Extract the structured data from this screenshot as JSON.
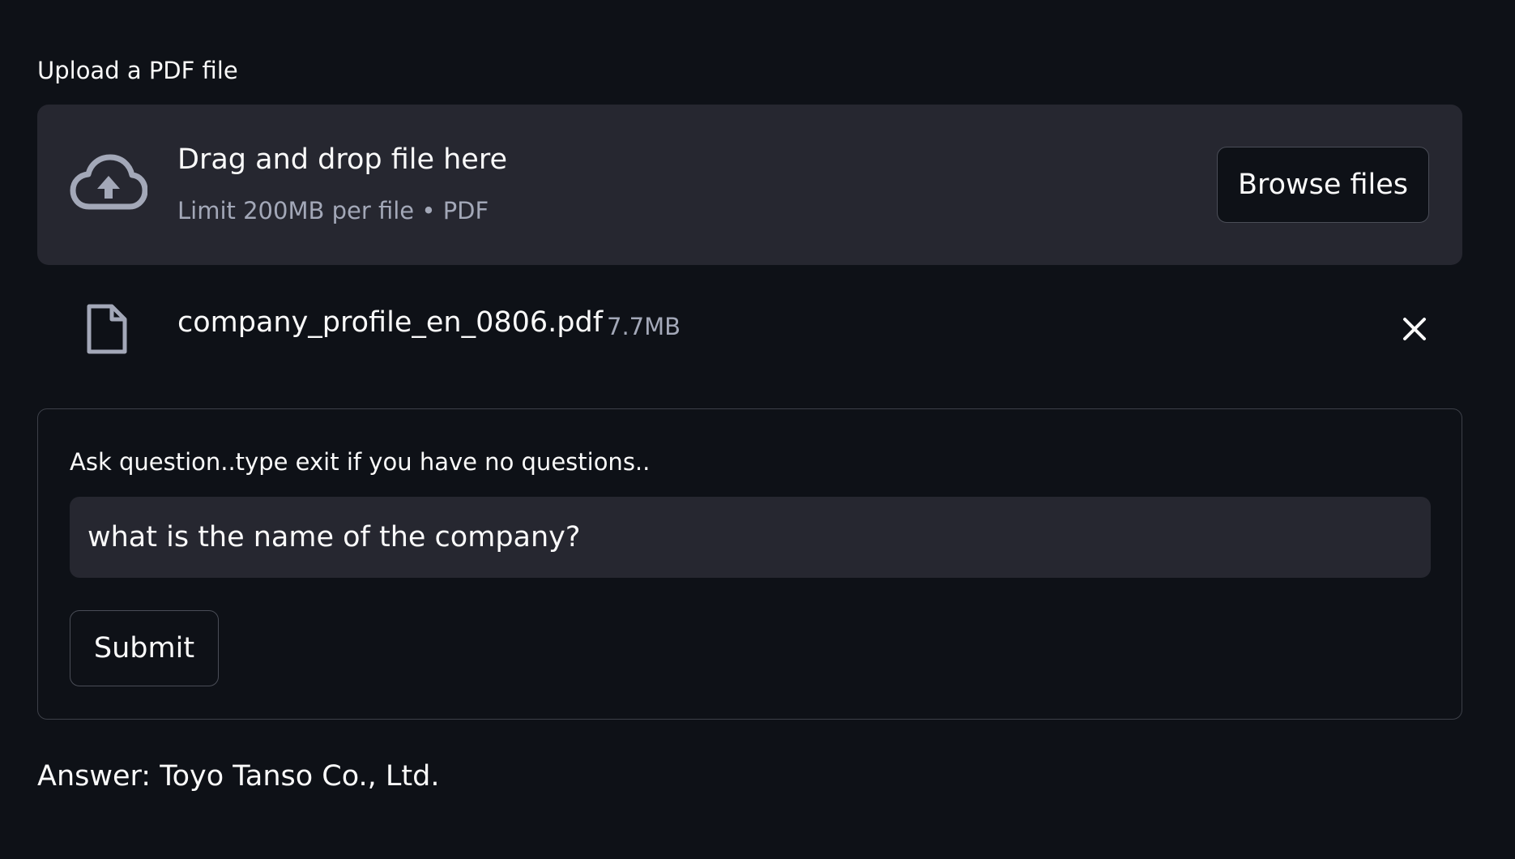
{
  "uploader": {
    "label": "Upload a PDF file",
    "drop_title": "Drag and drop file here",
    "drop_subtitle": "Limit 200MB per file • PDF",
    "browse_label": "Browse files",
    "icon": "cloud-upload-icon"
  },
  "uploaded_file": {
    "name": "company_profile_en_0806.pdf",
    "size": "7.7MB",
    "icon": "file-icon",
    "remove_icon": "close-icon"
  },
  "form": {
    "question_label": "Ask question..type exit if you have no questions..",
    "question_value": "what is the name of the company?",
    "submit_label": "Submit"
  },
  "answer": {
    "text": "Answer: Toyo Tanso Co., Ltd."
  },
  "colors": {
    "background": "#0e1117",
    "panel": "#262730",
    "text": "#fafafa",
    "muted": "#a3a8b8",
    "border": "#4a4d57"
  }
}
